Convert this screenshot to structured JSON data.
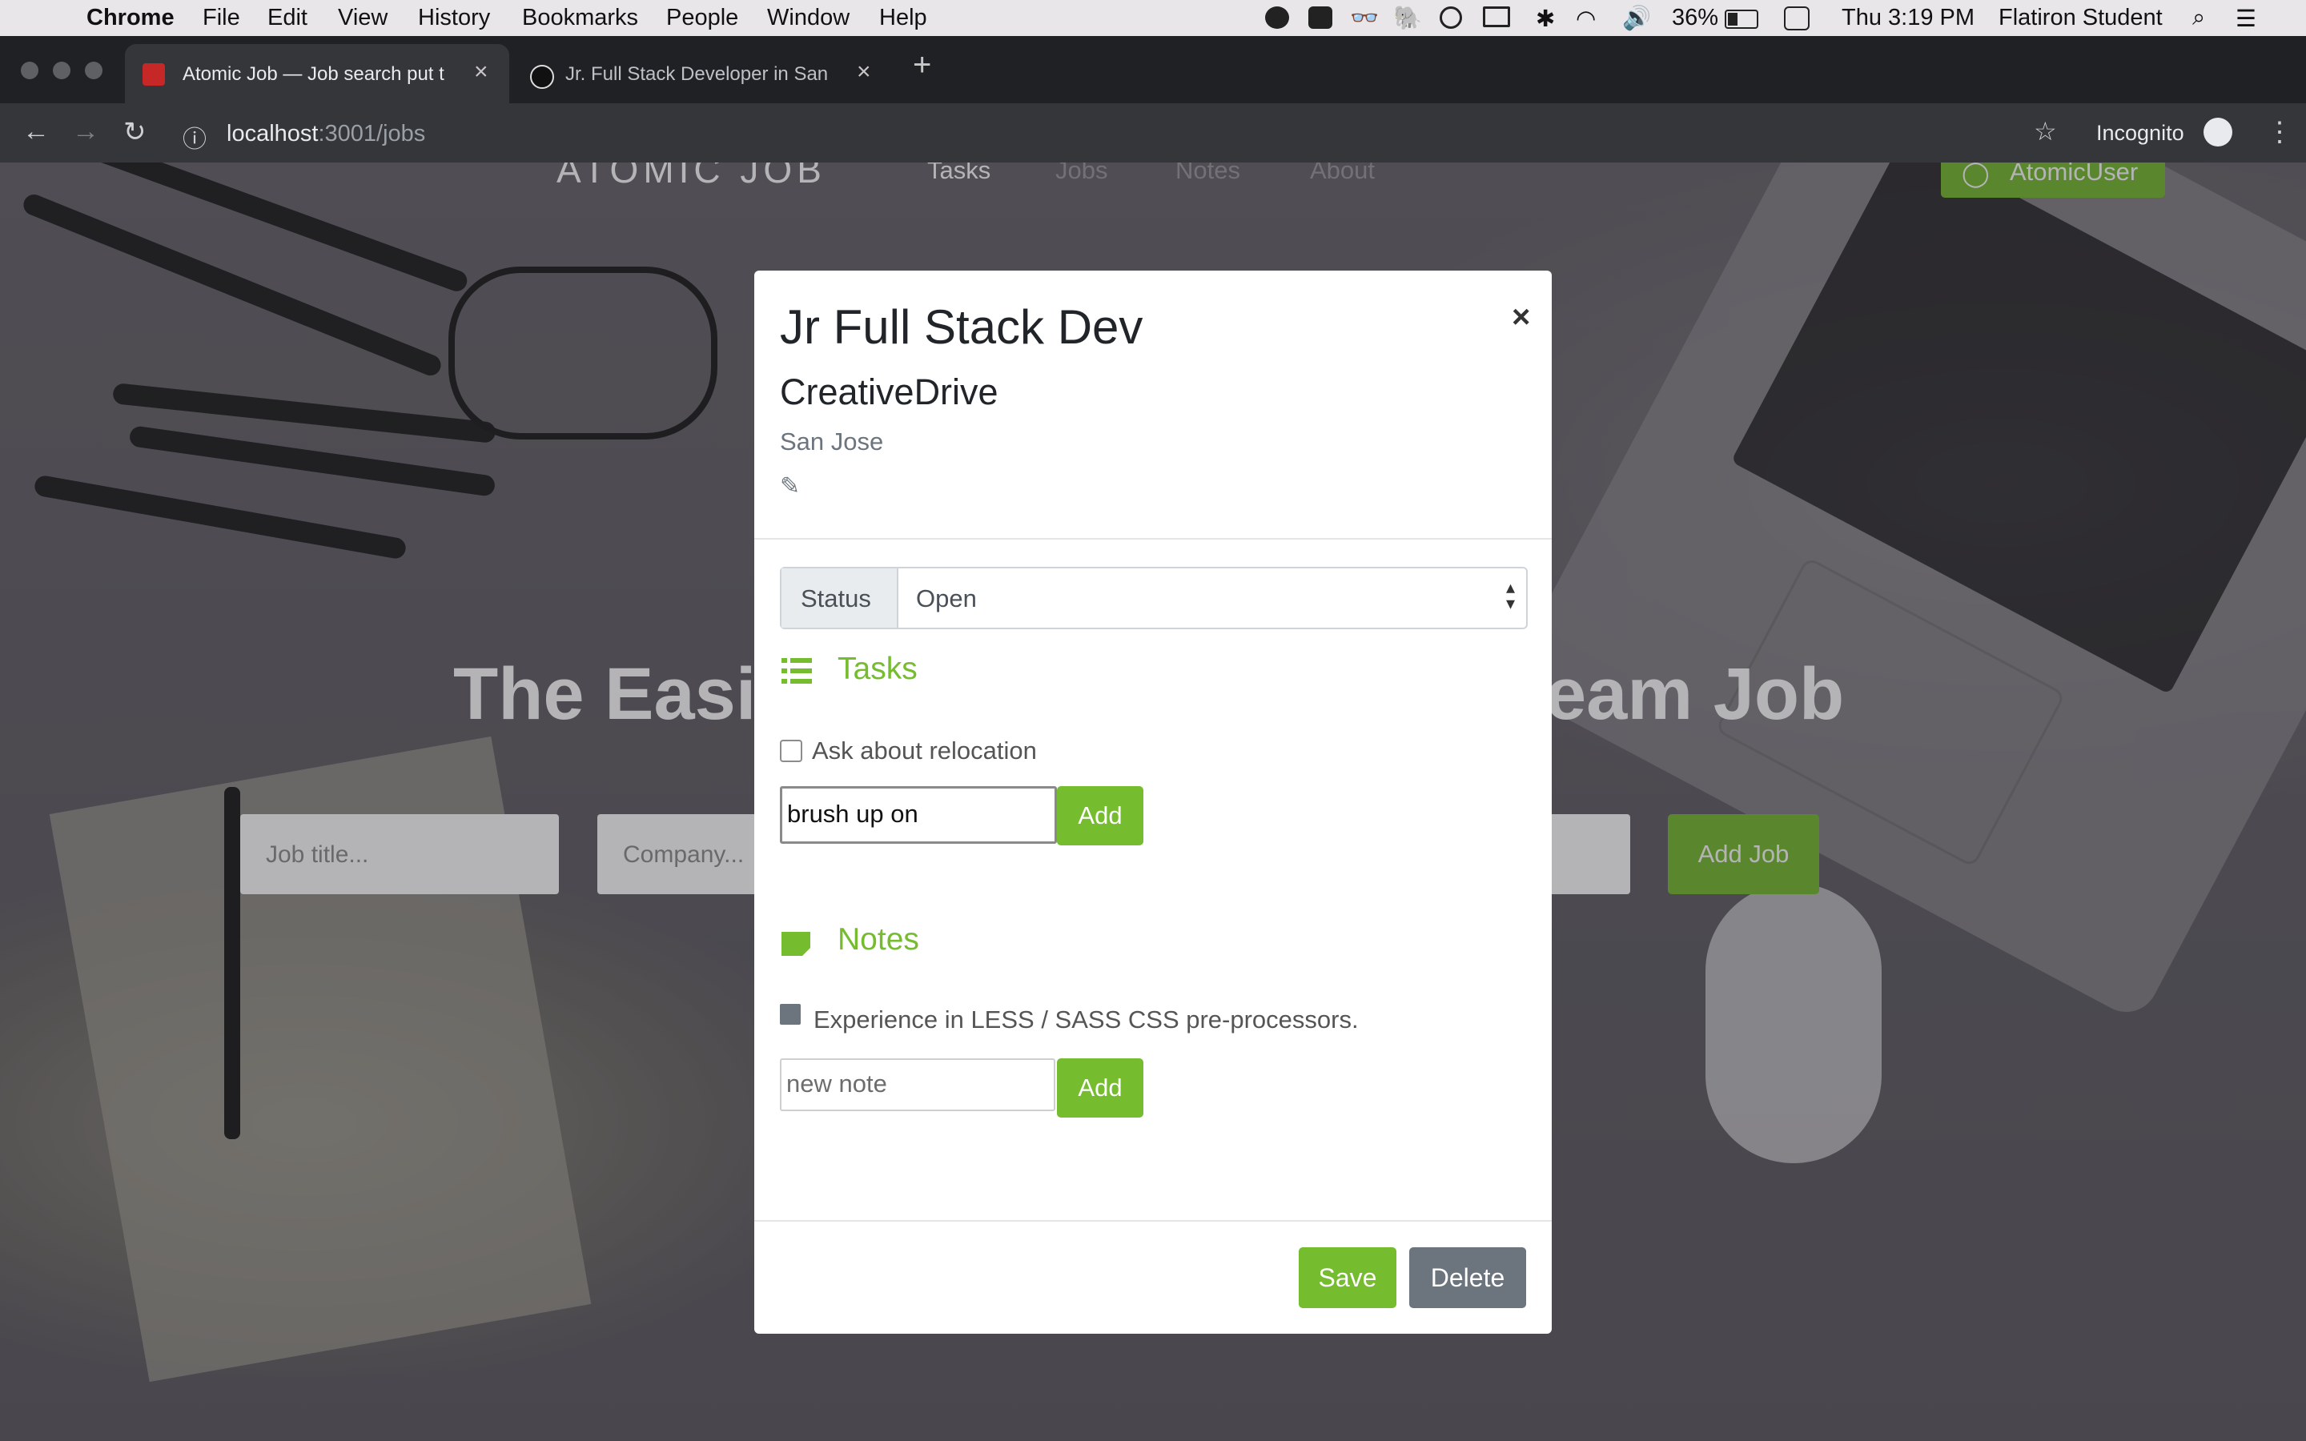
{
  "menubar": {
    "app": "Chrome",
    "menus": [
      "File",
      "Edit",
      "View",
      "History",
      "Bookmarks",
      "People",
      "Window",
      "Help"
    ],
    "battery": "36%",
    "clock": "Thu 3:19 PM",
    "user": "Flatiron Student"
  },
  "browser": {
    "tabs": [
      {
        "title": "Atomic Job — Job search put t",
        "icon": "atomic-job-favicon"
      },
      {
        "title": "Jr. Full Stack Developer in San",
        "icon": "site-favicon"
      }
    ],
    "url_host": "localhost",
    "url_path": ":3001/jobs",
    "incognito_label": "Incognito"
  },
  "site": {
    "brand": "ATOMIC JOB",
    "nav": [
      "Tasks",
      "Jobs",
      "Notes",
      "About"
    ],
    "user_button": "AtomicUser",
    "hero_left": "The Easi",
    "hero_right": "eam Job",
    "form": {
      "job_title_placeholder": "Job title...",
      "company_placeholder": "Company...",
      "add_job_label": "Add Job"
    }
  },
  "modal": {
    "job_title": "Jr Full Stack Dev",
    "company": "CreativeDrive",
    "location": "San Jose",
    "status_label": "Status",
    "status_value": "Open",
    "tasks_heading": "Tasks",
    "tasks": [
      {
        "label": "Ask about relocation",
        "checked": false
      }
    ],
    "task_input_value": "brush up on",
    "task_add_label": "Add",
    "notes_heading": "Notes",
    "notes": [
      "Experience in LESS / SASS CSS pre-processors."
    ],
    "note_input_placeholder": "new note",
    "note_add_label": "Add",
    "save_label": "Save",
    "delete_label": "Delete",
    "close_glyph": "×"
  },
  "colors": {
    "accent_green": "#75bc2f",
    "delete_gray": "#6c757d"
  }
}
